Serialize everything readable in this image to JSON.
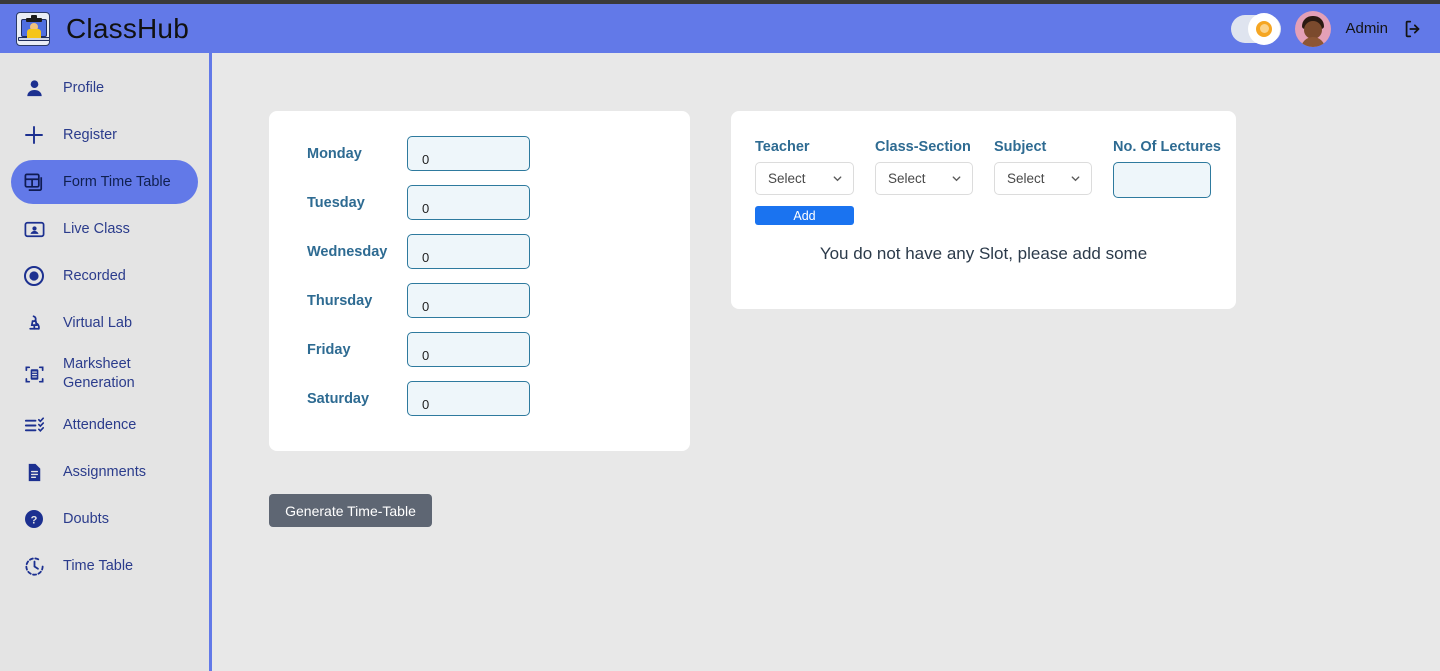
{
  "app": {
    "brand_name": "ClassHub",
    "logo_icon": "student-laptop-logo-icon",
    "accent_blue": "#6279e8",
    "header_bg": "#6279e8",
    "sidebar_bg": "#e4e4e4",
    "page_bg": "#e8e8e8"
  },
  "header": {
    "theme_toggle_icon": "sun-icon",
    "theme_toggle_state": "light",
    "avatar_icon": "user-avatar",
    "admin_label": "Admin",
    "logout_icon": "logout-icon"
  },
  "sidebar": {
    "items": [
      {
        "label": "Profile",
        "icon": "user-icon",
        "active": false
      },
      {
        "label": "Register",
        "icon": "plus-icon",
        "active": false
      },
      {
        "label": "Form Time Table",
        "icon": "table-grid-icon",
        "active": true
      },
      {
        "label": "Live Class",
        "icon": "video-card-icon",
        "active": false
      },
      {
        "label": "Recorded",
        "icon": "record-circle-icon",
        "active": false
      },
      {
        "label": "Virtual Lab",
        "icon": "microscope-icon",
        "active": false
      },
      {
        "label": "Marksheet Generation",
        "icon": "marksheet-scan-icon",
        "active": false
      },
      {
        "label": "Attendence",
        "icon": "checklist-icon",
        "active": false
      },
      {
        "label": "Assignments",
        "icon": "document-icon",
        "active": false
      },
      {
        "label": "Doubts",
        "icon": "question-circle-icon",
        "active": false
      },
      {
        "label": "Time Table",
        "icon": "clock-icon",
        "active": false
      }
    ]
  },
  "days_panel": {
    "rows": [
      {
        "label": "Monday",
        "value": "0"
      },
      {
        "label": "Tuesday",
        "value": "0"
      },
      {
        "label": "Wednesday",
        "value": "0"
      },
      {
        "label": "Thursday",
        "value": "0"
      },
      {
        "label": "Friday",
        "value": "0"
      },
      {
        "label": "Saturday",
        "value": "0"
      }
    ]
  },
  "slots_panel": {
    "headers": {
      "teacher": "Teacher",
      "class_section": "Class-Section",
      "subject": "Subject",
      "lectures": "No. Of Lectures"
    },
    "teacher_select": "Select",
    "class_section_select": "Select",
    "subject_select": "Select",
    "lectures_value": "",
    "add_label": "Add",
    "empty_message": "You do not have any Slot, please add some"
  },
  "footer_actions": {
    "generate_label": "Generate Time-Table"
  }
}
